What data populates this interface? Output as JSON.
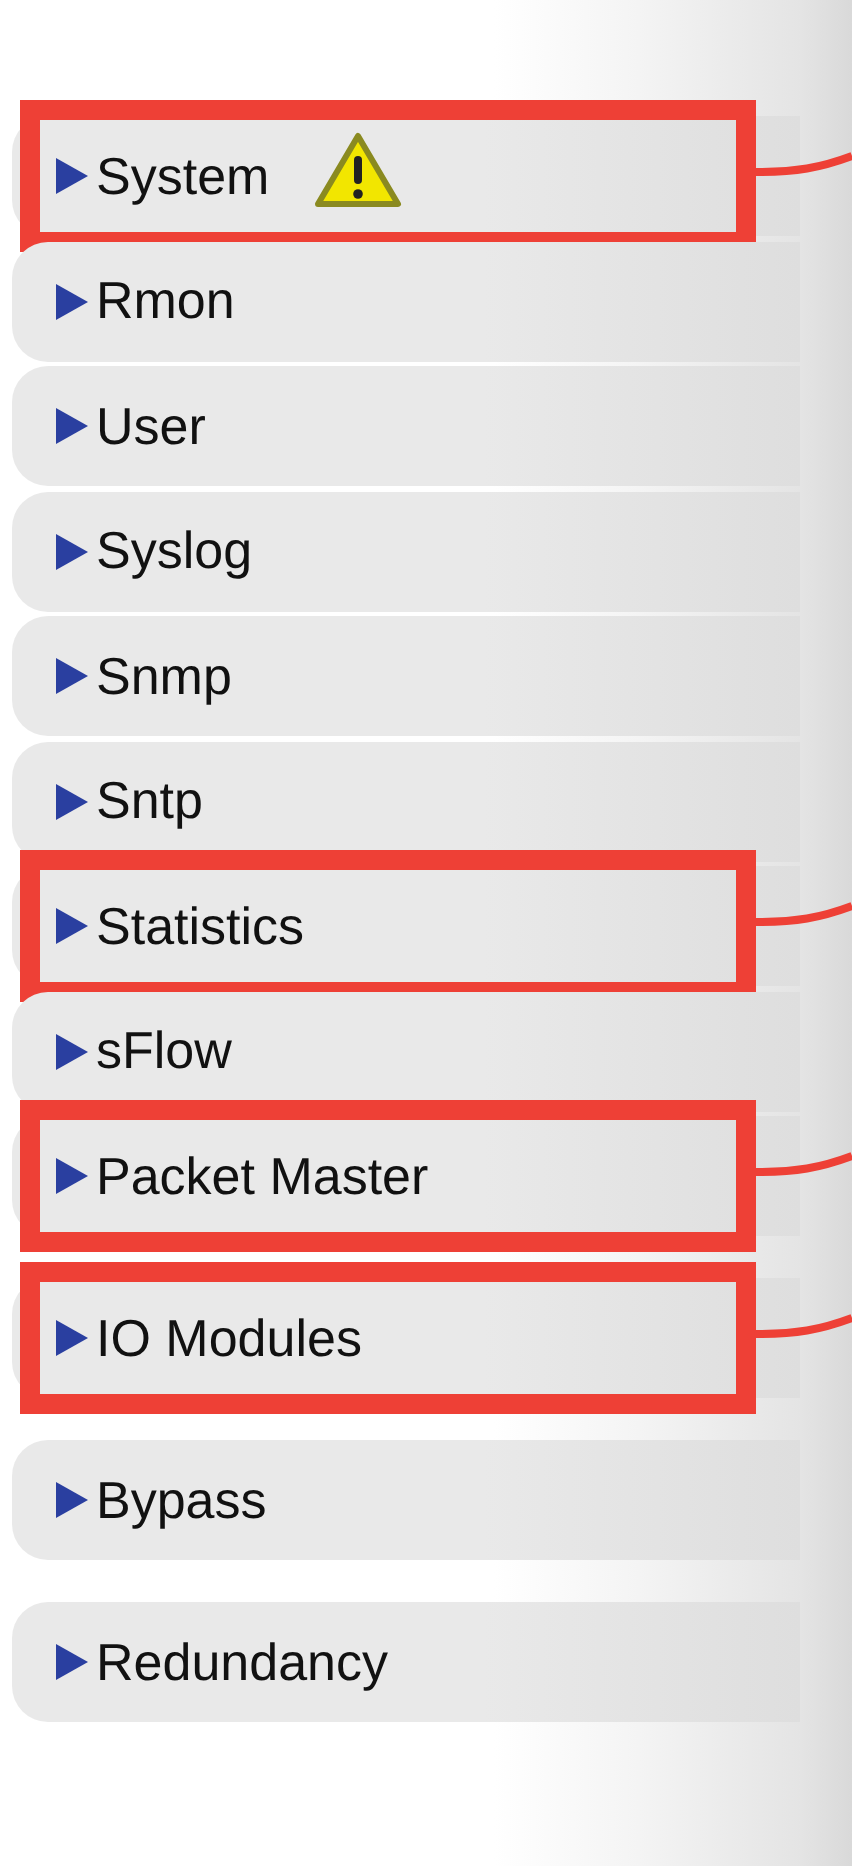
{
  "items": [
    {
      "label": "System",
      "warning": true,
      "highlighted": true
    },
    {
      "label": "Rmon",
      "warning": false,
      "highlighted": false
    },
    {
      "label": "User",
      "warning": false,
      "highlighted": false
    },
    {
      "label": "Syslog",
      "warning": false,
      "highlighted": false
    },
    {
      "label": "Snmp",
      "warning": false,
      "highlighted": false
    },
    {
      "label": "Sntp",
      "warning": false,
      "highlighted": false
    },
    {
      "label": "Statistics",
      "warning": false,
      "highlighted": true
    },
    {
      "label": "sFlow",
      "warning": false,
      "highlighted": false
    },
    {
      "label": "Packet Master",
      "warning": false,
      "highlighted": true
    },
    {
      "label": "IO Modules",
      "warning": false,
      "highlighted": true
    },
    {
      "label": "Bypass",
      "warning": false,
      "highlighted": false
    },
    {
      "label": "Redundancy",
      "warning": false,
      "highlighted": false
    }
  ]
}
